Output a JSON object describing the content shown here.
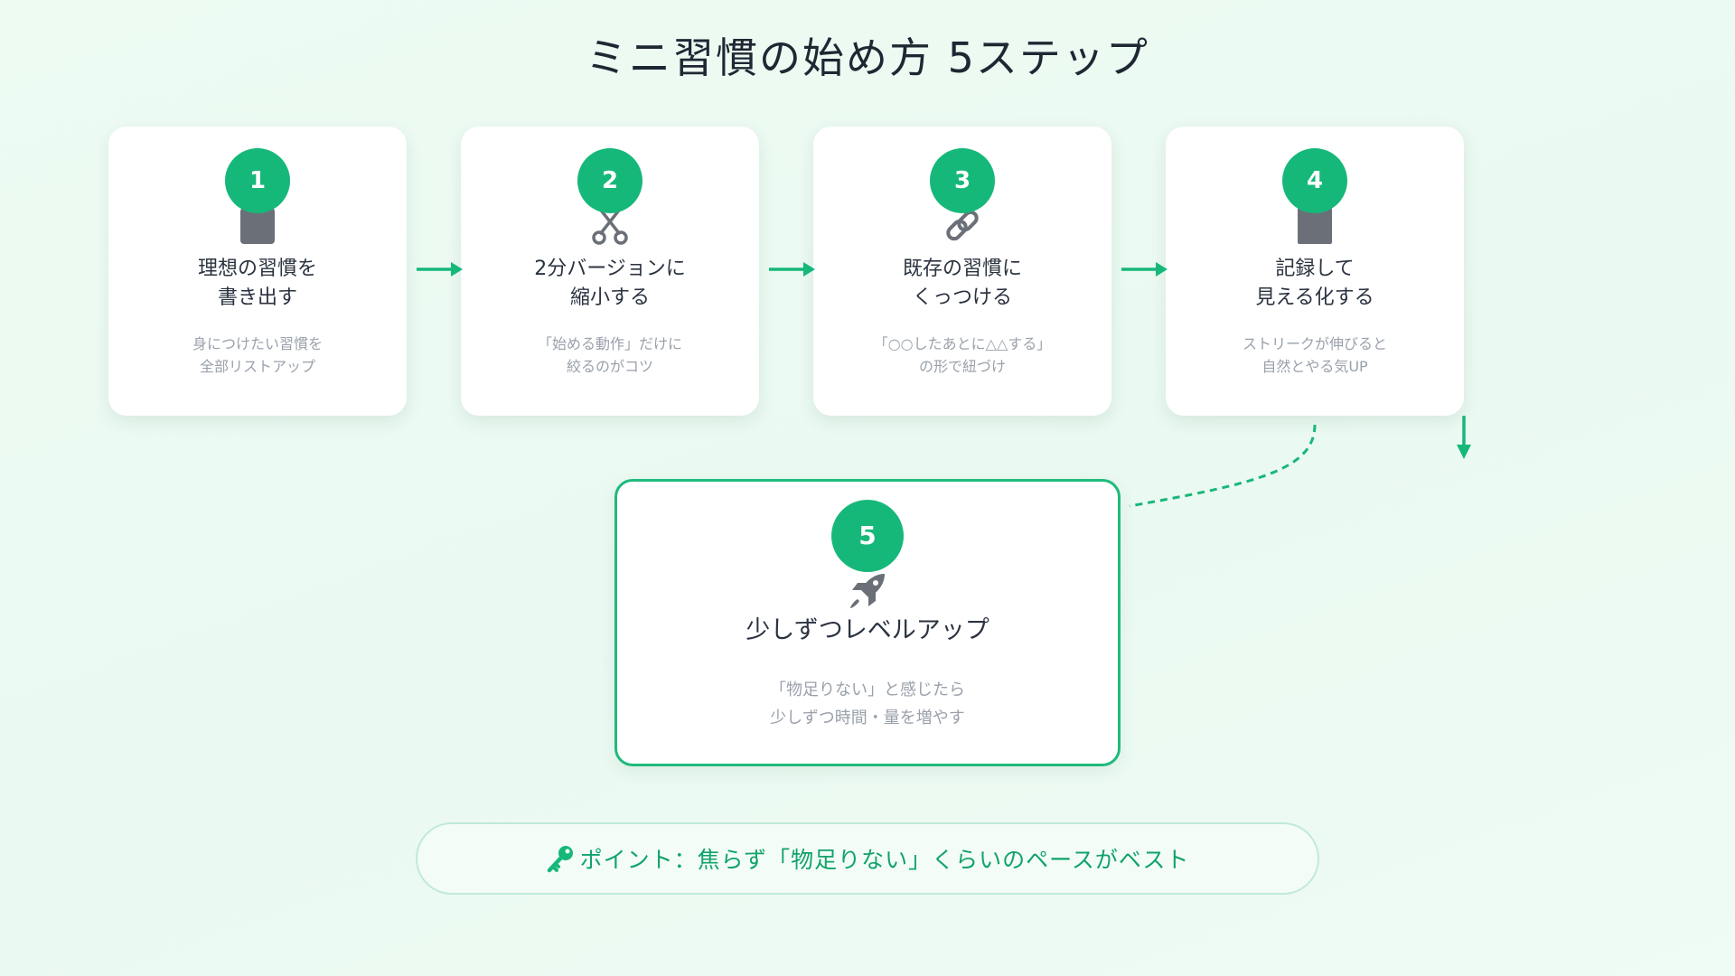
{
  "title": "ミニ習慣の始め方 5ステップ",
  "steps": [
    {
      "number": "1",
      "icon": "notepad-icon",
      "title_lines": [
        "理想の習慣を",
        "書き出す"
      ],
      "desc_lines": [
        "身につけたい習慣を",
        "全部リストアップ"
      ]
    },
    {
      "number": "2",
      "icon": "scissors-icon",
      "title_lines": [
        "2分バージョンに",
        "縮小する"
      ],
      "desc_lines": [
        "「始める動作」だけに",
        "絞るのがコツ"
      ]
    },
    {
      "number": "3",
      "icon": "link-icon",
      "title_lines": [
        "既存の習慣に",
        "くっつける"
      ],
      "desc_lines": [
        "「○○したあとに△△する」",
        "の形で紐づけ"
      ]
    },
    {
      "number": "4",
      "icon": "chart-icon",
      "title_lines": [
        "記録して",
        "見える化する"
      ],
      "desc_lines": [
        "ストリークが伸びると",
        "自然とやる気UP"
      ]
    },
    {
      "number": "5",
      "icon": "rocket-icon",
      "title_lines": [
        "少しずつレベルアップ"
      ],
      "desc_lines": [
        "「物足りない」と感じたら",
        "少しずつ時間・量を増やす"
      ]
    }
  ],
  "tip": {
    "icon": "key-icon",
    "text": "ポイント：焦らず「物足りない」くらいのペースがベスト"
  },
  "colors": {
    "accent": "#16b87a",
    "background": "#edfbf3",
    "icon_gray": "#6b7078"
  }
}
